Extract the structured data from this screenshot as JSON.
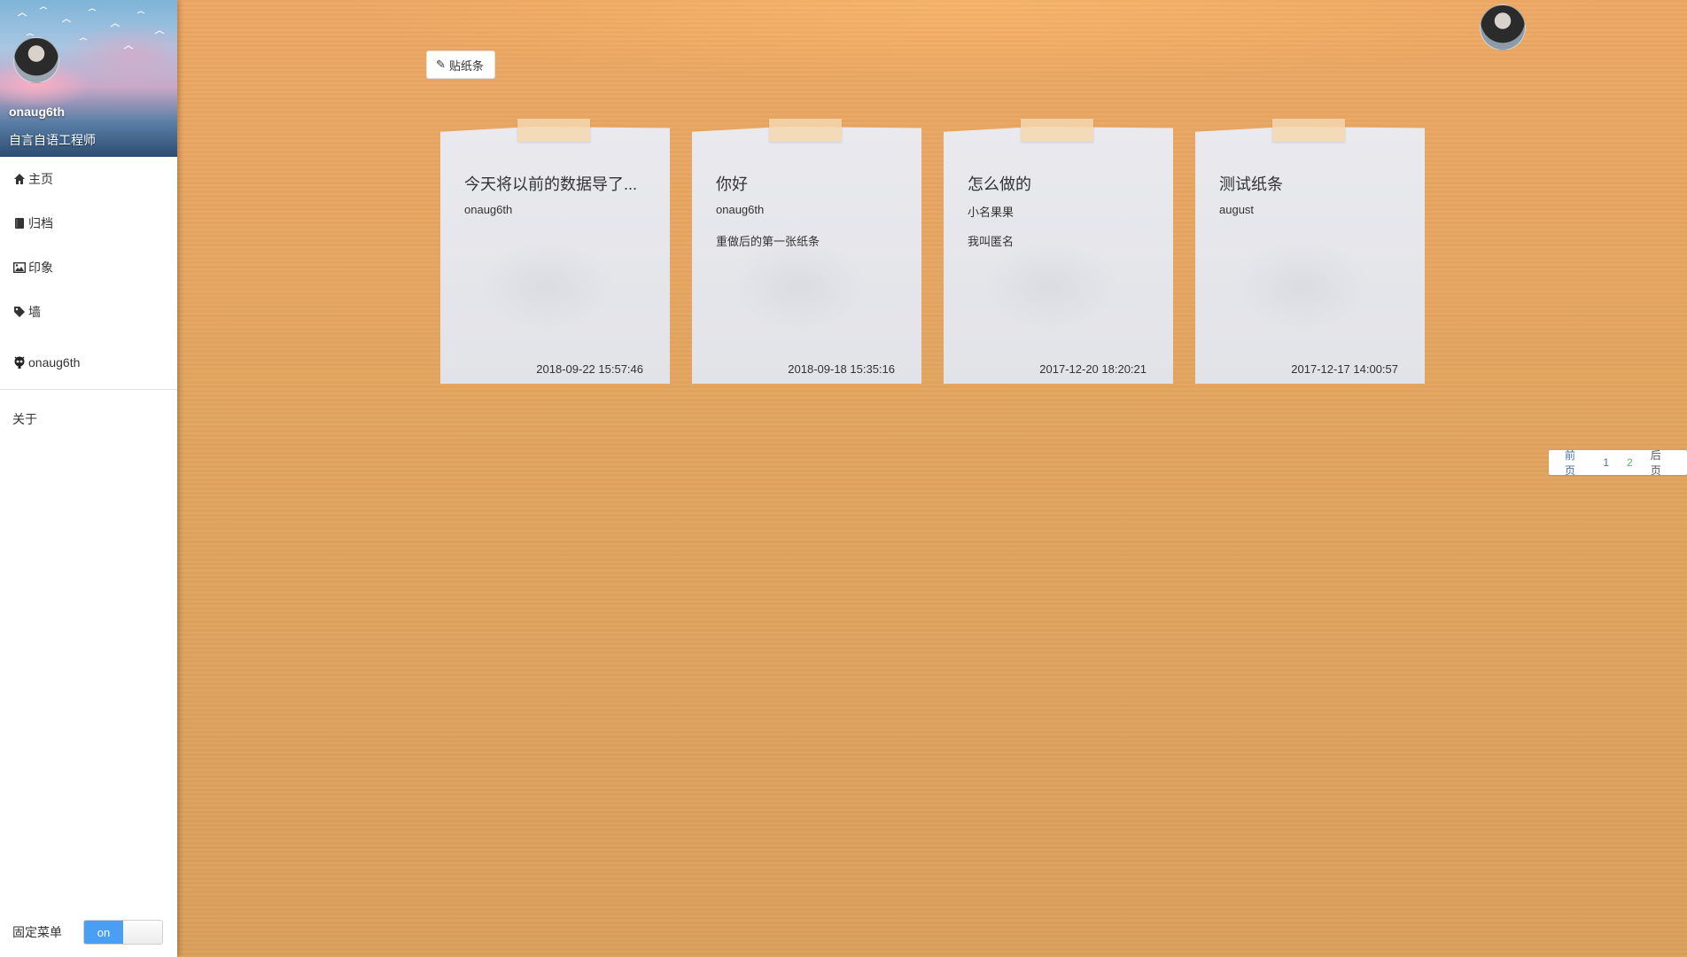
{
  "profile": {
    "name": "onaug6th",
    "bio": "自言自语工程师"
  },
  "nav": {
    "items": [
      {
        "label": "主页",
        "icon": "home-icon"
      },
      {
        "label": "归档",
        "icon": "book-icon"
      },
      {
        "label": "印象",
        "icon": "image-icon"
      },
      {
        "label": "墙",
        "icon": "tag-icon"
      },
      {
        "label": "onaug6th",
        "icon": "github-icon"
      }
    ],
    "about": "关于"
  },
  "fix_menu": {
    "label": "固定菜单",
    "toggle_on": "on"
  },
  "toolbar": {
    "compose_label": "贴纸条"
  },
  "notes": [
    {
      "title": "今天将以前的数据导了...",
      "author": "onaug6th",
      "content": "",
      "time": "2018-09-22 15:57:46"
    },
    {
      "title": "你好",
      "author": "onaug6th",
      "content": "重做后的第一张纸条",
      "time": "2018-09-18 15:35:16"
    },
    {
      "title": "怎么做的",
      "author": "小名果果",
      "content": "我叫匿名",
      "time": "2017-12-20 18:20:21"
    },
    {
      "title": "测试纸条",
      "author": "august",
      "content": "",
      "time": "2017-12-17 14:00:57"
    }
  ],
  "pager": {
    "prev": "前页",
    "pages": [
      "1",
      "2"
    ],
    "next": "后页"
  },
  "colors": {
    "accent": "#4a9ef4",
    "background": "#e2a564",
    "current_page": "#5cb85c"
  }
}
